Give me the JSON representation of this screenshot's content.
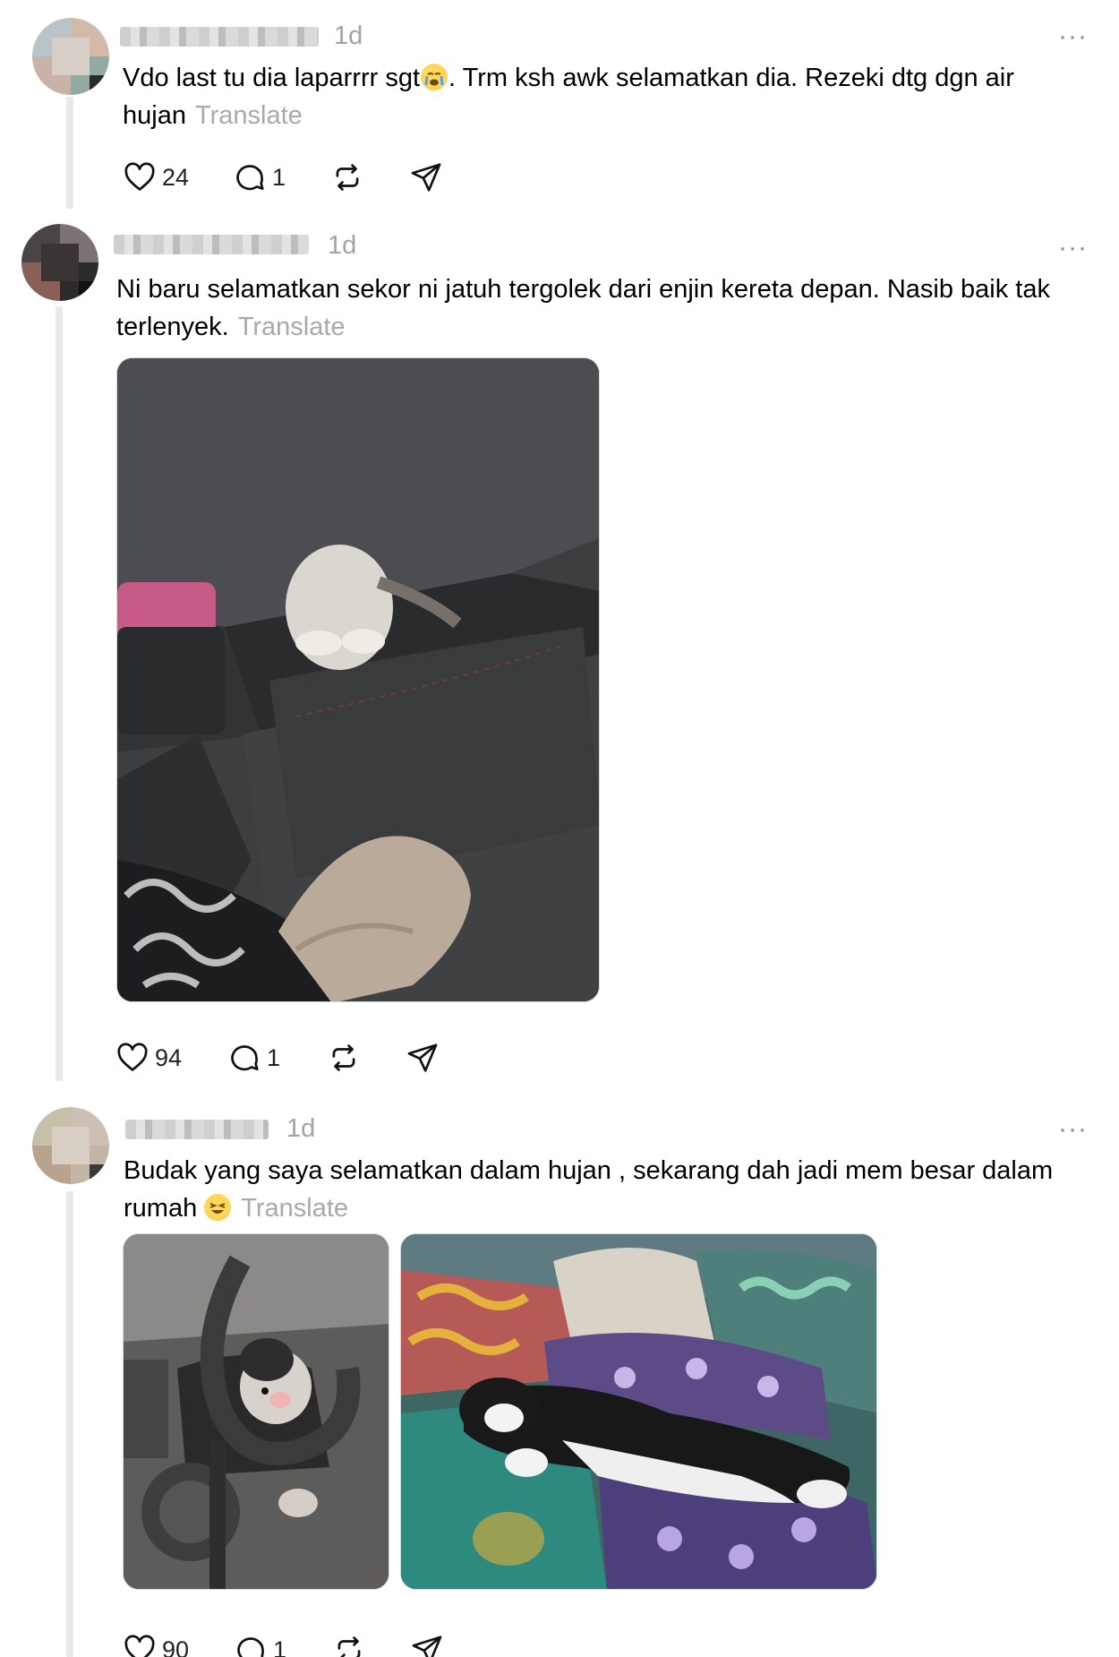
{
  "posts": [
    {
      "time": "1d",
      "text": "Vdo last tu dia laparrrr sgt",
      "emoji_1": "😭",
      "text_after_emoji": ". Trm ksh awk selamatkan dia. Rezeki dtg dgn air hujan",
      "translate": "Translate",
      "likes": "24",
      "replies": "1",
      "more_label": "···"
    },
    {
      "time": "1d",
      "text": "Ni baru selamatkan sekor ni jatuh tergolek dari enjin kereta depan. Nasib baik tak terlenyek.",
      "translate": "Translate",
      "likes": "94",
      "replies": "1",
      "more_label": "···"
    },
    {
      "time": "1d",
      "text": "Budak yang saya selamatkan dalam hujan , sekarang dah jadi mem besar dalam rumah",
      "emoji_1": "🤣",
      "translate": "Translate",
      "likes": "90",
      "replies": "1",
      "more_label": "···"
    }
  ],
  "icons": {
    "like": "heart-icon",
    "reply": "comment-icon",
    "repost": "repost-icon",
    "share": "share-icon"
  }
}
